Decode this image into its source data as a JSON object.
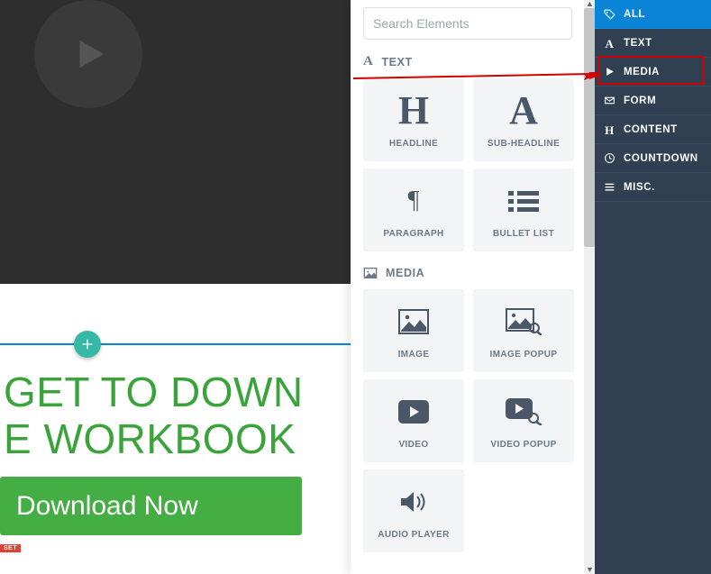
{
  "canvas": {
    "headline_line1": "GET TO DOWN",
    "headline_line2": "E WORKBOOK",
    "download_label": "Download Now",
    "tag": "SET"
  },
  "panel": {
    "search_placeholder": "Search Elements",
    "sections": {
      "text": {
        "title": "TEXT",
        "tiles": [
          {
            "name": "headline",
            "label": "HEADLINE"
          },
          {
            "name": "sub-headline",
            "label": "SUB-HEADLINE"
          },
          {
            "name": "paragraph",
            "label": "PARAGRAPH"
          },
          {
            "name": "bullet-list",
            "label": "BULLET LIST"
          }
        ]
      },
      "media": {
        "title": "MEDIA",
        "tiles": [
          {
            "name": "image",
            "label": "IMAGE"
          },
          {
            "name": "image-popup",
            "label": "IMAGE POPUP"
          },
          {
            "name": "video",
            "label": "VIDEO"
          },
          {
            "name": "video-popup",
            "label": "VIDEO POPUP"
          },
          {
            "name": "audio-player",
            "label": "AUDIO PLAYER"
          }
        ]
      }
    }
  },
  "sidebar": {
    "items": [
      {
        "name": "all",
        "label": "ALL",
        "active": true
      },
      {
        "name": "text",
        "label": "TEXT"
      },
      {
        "name": "media",
        "label": "MEDIA",
        "highlighted": true
      },
      {
        "name": "form",
        "label": "FORM"
      },
      {
        "name": "content",
        "label": "CONTENT"
      },
      {
        "name": "countdown",
        "label": "COUNTDOWN"
      },
      {
        "name": "misc",
        "label": "MISC."
      }
    ]
  }
}
